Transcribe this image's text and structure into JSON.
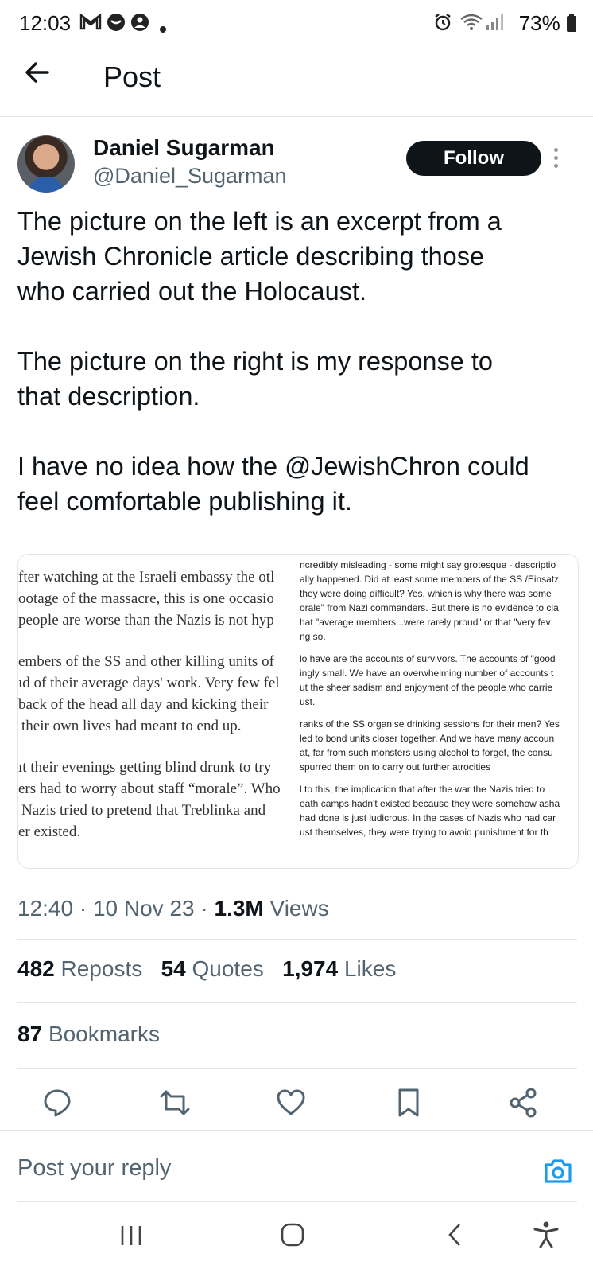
{
  "status_bar": {
    "time": "12:03",
    "battery": "73%"
  },
  "header": {
    "title": "Post"
  },
  "author": {
    "name": "Daniel Sugarman",
    "handle": "@Daniel_Sugarman",
    "follow_label": "Follow"
  },
  "tweet": {
    "lines_p1": [
      "The picture on the left is an excerpt from a",
      "Jewish Chronicle article describing those",
      "who carried out the Holocaust."
    ],
    "lines_p2": [
      "The picture on the right is my response to",
      "that description."
    ],
    "lines_p3": [
      "I have no idea how the @JewishChron could",
      "feel comfortable publishing it."
    ]
  },
  "media": {
    "left_lines": [
      "fter watching at the Israeli embassy the otl",
      "ootage of the massacre, this is one occasio",
      "people are worse than the Nazis is not hyp",
      "embers of the SS and other killing units of",
      "ıd of their average days' work. Very few fel",
      "back of the head all day and kicking their",
      "their own lives had meant to end up.",
      "ıt their evenings getting blind drunk to try",
      "ers had to worry about staff “morale”. Who",
      "Nazis tried to pretend that Treblinka and",
      "er existed."
    ],
    "right_lines": [
      "ncredibly misleading - some might say grotesque - descriptio",
      "ally happened. Did at least some members of the SS /Einsatz",
      "they were doing difficult? Yes, which is why there was some",
      "orale\" from Nazi commanders. But there is no evidence to cla",
      "hat \"average members...were rarely proud\" or that \"very fev",
      "ng so.",
      "lo have are the accounts of survivors. The accounts of \"good",
      "ingly small. We have an overwhelming number of accounts t",
      "ut the sheer sadism and enjoyment of the people who carrie",
      "ust.",
      "ranks of the SS organise drinking sessions for their men? Yes",
      "led to bond units closer together. And we have many accoun",
      "at, far from such monsters using alcohol to forget, the consu",
      "spurred them on to carry out further atrocities",
      "l to this, the implication that after the war the Nazis tried to",
      "eath camps hadn't existed because they were somehow asha",
      "had done is just ludicrous. In the cases of Nazis who had car",
      "ust themselves, they were trying to avoid punishment for th"
    ]
  },
  "meta": {
    "time": "12:40",
    "date": "10 Nov 23",
    "views_count": "1.3M",
    "views_label": "Views"
  },
  "stats": {
    "reposts_count": "482",
    "reposts_label": "Reposts",
    "quotes_count": "54",
    "quotes_label": "Quotes",
    "likes_count": "1,974",
    "likes_label": "Likes",
    "bookmarks_count": "87",
    "bookmarks_label": "Bookmarks"
  },
  "reply": {
    "placeholder": "Post your reply"
  },
  "colors": {
    "accent": "#1d9bf0",
    "text": "#0f1419",
    "muted": "#536471"
  },
  "icons": [
    "reply-icon",
    "repost-icon",
    "like-icon",
    "bookmark-icon",
    "share-icon",
    "camera-icon"
  ]
}
